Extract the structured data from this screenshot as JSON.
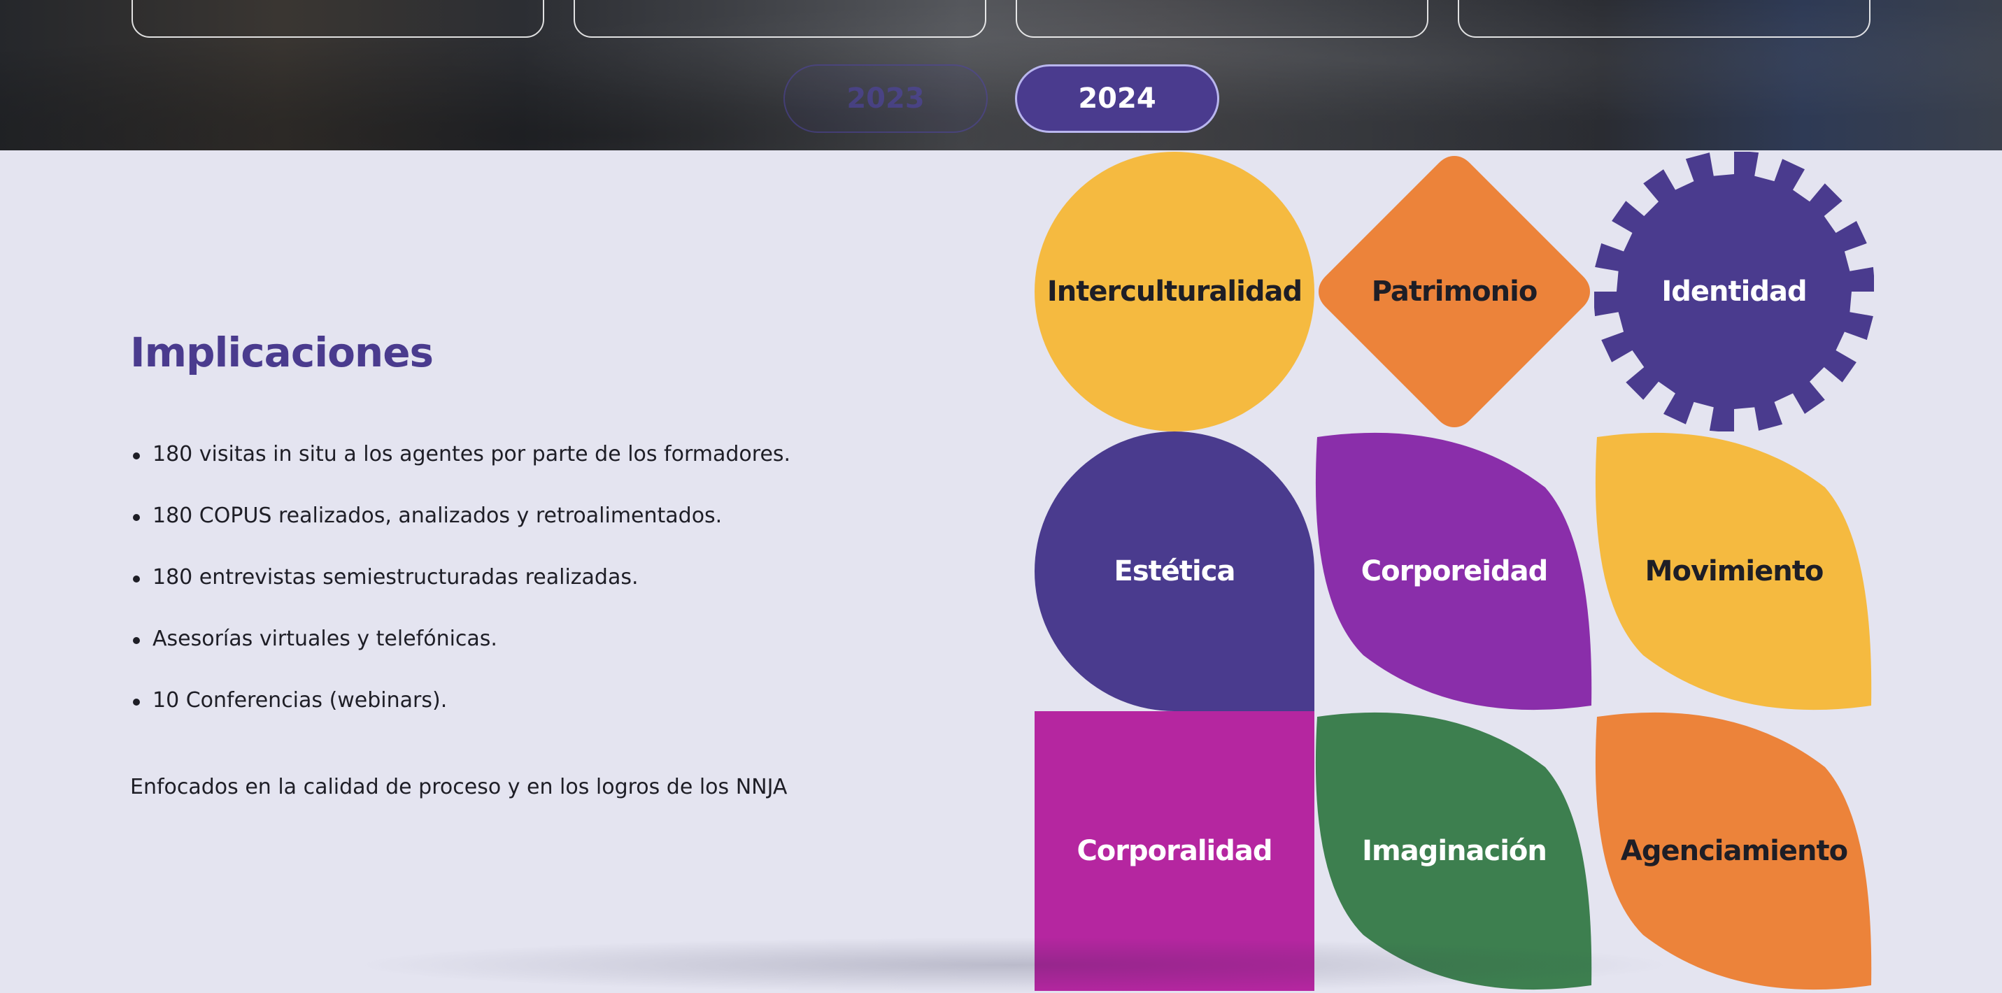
{
  "year_selector": {
    "years": [
      "2023",
      "2024"
    ],
    "active": "2024"
  },
  "section": {
    "title": "Implicaciones",
    "items": [
      "180 visitas in situ a los agentes por parte de los formadores.",
      "180 COPUS realizados, analizados y retroalimentados.",
      "180 entrevistas semiestructuradas realizadas.",
      "Asesorías virtuales y telefónicas.",
      "10 Conferencias (webinars)."
    ],
    "closing": "Enfocados en la calidad de proceso y en los logros de los NNJA"
  },
  "tiles": [
    {
      "label": "Interculturalidad",
      "shape": "circle",
      "color": "#f5ba40",
      "text_color": "#1e1e26"
    },
    {
      "label": "Patrimonio",
      "shape": "diamond",
      "color": "#ec833a",
      "text_color": "#1e1e26"
    },
    {
      "label": "Identidad",
      "shape": "gear",
      "color": "#4a3b8e",
      "text_color": "#ffffff"
    },
    {
      "label": "Estética",
      "shape": "teardrop",
      "color": "#4a3b8e",
      "text_color": "#ffffff"
    },
    {
      "label": "Corporeidad",
      "shape": "leaf",
      "color": "#8a2eaa",
      "text_color": "#ffffff"
    },
    {
      "label": "Movimiento",
      "shape": "leaf",
      "color": "#f5ba40",
      "text_color": "#1e1e26"
    },
    {
      "label": "Corporalidad",
      "shape": "square",
      "color": "#b526a0",
      "text_color": "#ffffff"
    },
    {
      "label": "Imaginación",
      "shape": "leaf",
      "color": "#3d7f4f",
      "text_color": "#ffffff"
    },
    {
      "label": "Agenciamiento",
      "shape": "leaf",
      "color": "#ec833a",
      "text_color": "#1e1e26"
    }
  ]
}
